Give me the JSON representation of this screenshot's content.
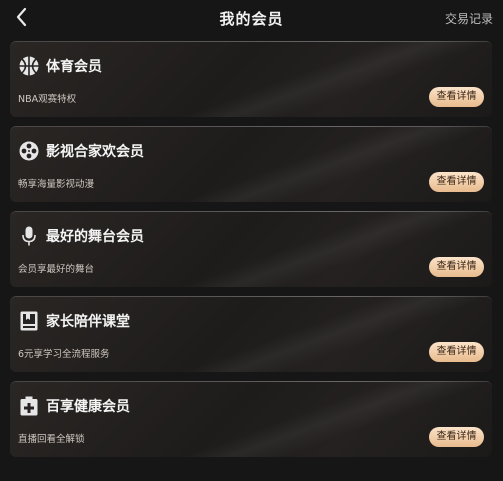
{
  "header": {
    "title": "我的会员",
    "records_label": "交易记录",
    "back_icon": "chevron-left-icon"
  },
  "memberships": [
    {
      "title": "体育会员",
      "desc": "NBA观赛特权",
      "button": "查看详情",
      "icon": "basketball-icon"
    },
    {
      "title": "影视合家欢会员",
      "desc": "畅享海量影视动漫",
      "button": "查看详情",
      "icon": "film-reel-icon"
    },
    {
      "title": "最好的舞台会员",
      "desc": "会员享最好的舞台",
      "button": "查看详情",
      "icon": "microphone-icon"
    },
    {
      "title": "家长陪伴课堂",
      "desc": "6元享学习全流程服务",
      "button": "查看详情",
      "icon": "book-icon"
    },
    {
      "title": "百享健康会员",
      "desc": "直播回看全解锁",
      "button": "查看详情",
      "icon": "medical-cross-icon"
    }
  ],
  "colors": {
    "background": "#161616",
    "button_gradient_top": "#fbe3c9",
    "button_gradient_bottom": "#e8bb8d"
  }
}
